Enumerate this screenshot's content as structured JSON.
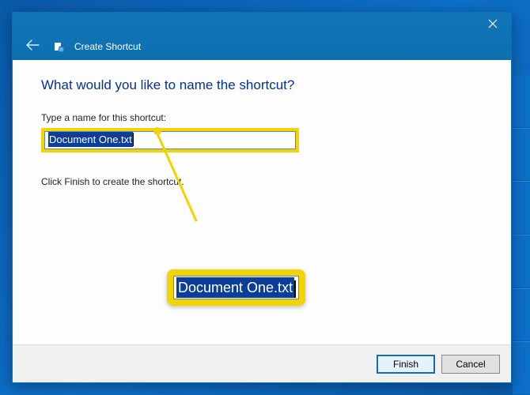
{
  "window": {
    "title": "Create Shortcut"
  },
  "heading": "What would you like to name the shortcut?",
  "field_label": "Type a name for this shortcut:",
  "input_value": "Document One.txt",
  "instruction": "Click Finish to create the shortcut.",
  "magnify_value": "Document One.txt",
  "footer": {
    "finish": "Finish",
    "cancel": "Cancel"
  }
}
